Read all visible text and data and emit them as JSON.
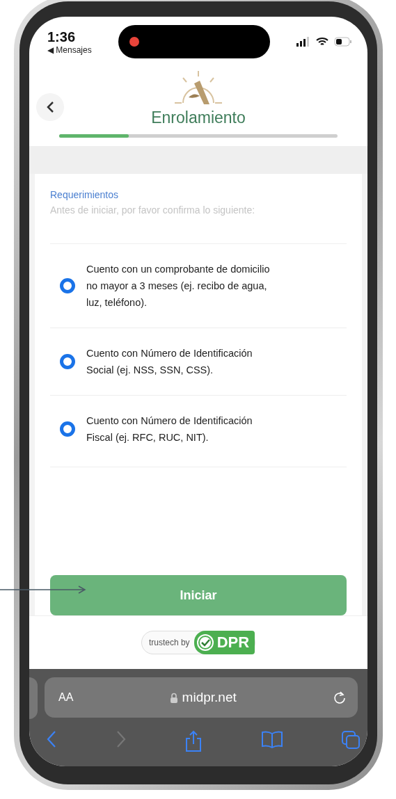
{
  "status_bar": {
    "time": "1:36",
    "back_app": "◀ Mensajes",
    "recording": true
  },
  "header": {
    "title": "Enrolamiento",
    "progress": {
      "level": 0.25
    }
  },
  "requirements": {
    "heading": "Requerimientos",
    "subtitle": "Antes de iniciar, por favor confirma lo siguiente:",
    "items": [
      {
        "text": "Cuento con un comprobante de domicilio no mayor a 3 meses (ej. recibo de agua, luz, teléfono).",
        "checked": true
      },
      {
        "text": "Cuento con Número de Identificación Social (ej. NSS, SSN, CSS).",
        "checked": true
      },
      {
        "text": "Cuento con Número de Identificación Fiscal (ej. RFC, RUC, NIT).",
        "checked": true
      }
    ]
  },
  "start_button": {
    "label": "Iniciar"
  },
  "footer_badge": {
    "prefix": "trustech by",
    "brand": "DPR"
  },
  "browser": {
    "text_size": "AA",
    "url": "midpr.net",
    "back_disabled": false,
    "forward_disabled": true
  }
}
